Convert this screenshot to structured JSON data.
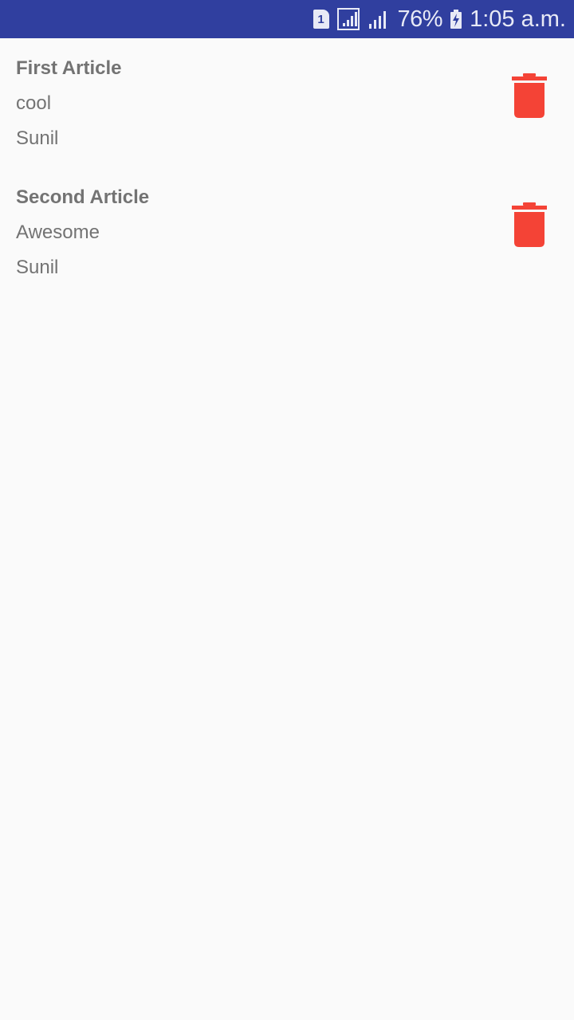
{
  "status_bar": {
    "sim_slot": "1",
    "battery_percent": "76%",
    "time": "1:05 a.m."
  },
  "colors": {
    "status_bar": "#303f9f",
    "background": "#fafafa",
    "text": "#737373",
    "delete_icon": "#f44336"
  },
  "articles": [
    {
      "title": "First Article",
      "description": "cool",
      "author": "Sunil",
      "action_icon": "trash-icon"
    },
    {
      "title": "Second Article",
      "description": "Awesome",
      "author": "Sunil",
      "action_icon": "trash-icon"
    }
  ]
}
